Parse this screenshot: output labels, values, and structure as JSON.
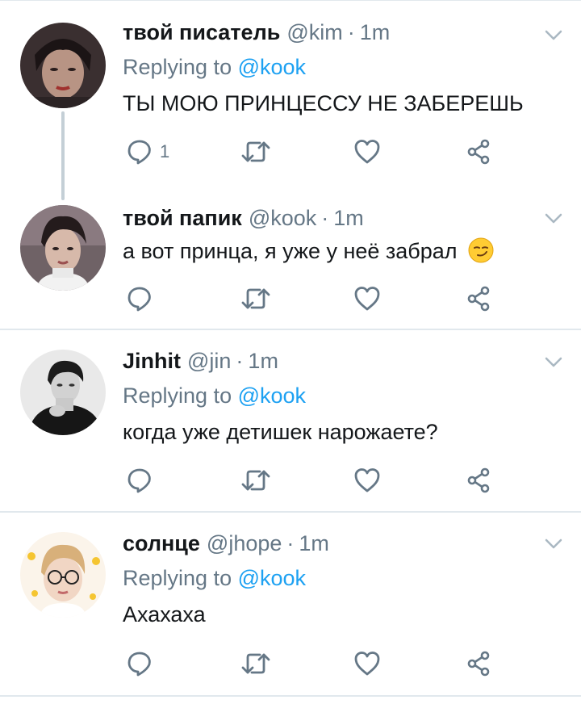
{
  "tweets": [
    {
      "name": "твой писатель",
      "handle": "@kim",
      "dot": "·",
      "time": "1m",
      "replying_prefix": "Replying to",
      "replying_mention": "@kook",
      "text": "ТЫ МОЮ ПРИНЦЕССУ НЕ ЗАБЕРЕШЬ",
      "reply_count": "1"
    },
    {
      "name": "твой папик",
      "handle": "@kook",
      "dot": "·",
      "time": "1m",
      "text": "а вот принца, я уже у неё забрал",
      "emoji": "smirking-face"
    },
    {
      "name": "Jinhit",
      "handle": "@jin",
      "dot": "·",
      "time": "1m",
      "replying_prefix": "Replying to",
      "replying_mention": "@kook",
      "text": "когда уже детишек нарожаете?"
    },
    {
      "name": "солнце",
      "handle": "@jhope",
      "dot": "·",
      "time": "1m",
      "replying_prefix": "Replying to",
      "replying_mention": "@kook",
      "text": "Ахахаха"
    }
  ],
  "icons": {
    "reply": "reply-icon",
    "retweet": "retweet-icon",
    "like": "heart-icon",
    "share": "share-icon",
    "more": "chevron-down-icon"
  },
  "colors": {
    "text": "#14171a",
    "secondary": "#657786",
    "link": "#1da1f2",
    "divider": "#e1e8ed",
    "thread_line": "#c4cfd6"
  }
}
